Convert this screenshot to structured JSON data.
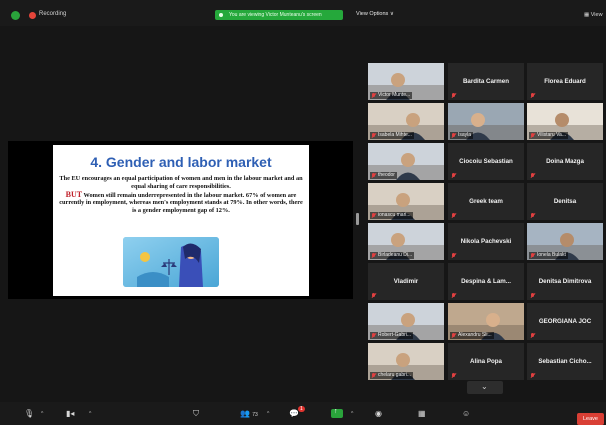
{
  "topbar": {
    "recording_label": "Recording",
    "viewing_banner": "You are viewing Victor Munteanu's screen",
    "view_options": "View Options ∨",
    "view_label": "View"
  },
  "slide": {
    "title": "4. Gender and labor market",
    "para1": "The EU encourages an equal participation of women and men in the labour market and an equal sharing of care responsibilities.",
    "but": "BUT",
    "para2": " Women still remain underrepresented in the labour market. 67% of women are currently in employment, whereas men's employment stands at 79%. In other words, there is a gender employment gap of 12%."
  },
  "participants": [
    {
      "name": "Victor Munte...",
      "video": true,
      "active": true,
      "muted": true
    },
    {
      "name": "Bardita Carmen",
      "video": false,
      "muted": true
    },
    {
      "name": "Florea Eduard",
      "video": false,
      "muted": true
    },
    {
      "name": "Isabela Mihte...",
      "video": true,
      "muted": true
    },
    {
      "name": "Isayla",
      "video": true,
      "muted": true
    },
    {
      "name": "Vilistaru Va...",
      "video": true,
      "muted": true
    },
    {
      "name": "theodor",
      "video": true,
      "muted": true
    },
    {
      "name": "Ciocoiu Sebastian",
      "video": false,
      "muted": true
    },
    {
      "name": "Doina Mazga",
      "video": false,
      "muted": true
    },
    {
      "name": "ionascu mari...",
      "video": true,
      "muted": true
    },
    {
      "name": "Greek team",
      "video": false,
      "muted": true
    },
    {
      "name": "Denitsa",
      "video": false,
      "muted": true
    },
    {
      "name": "Birladeanu Di...",
      "video": true,
      "muted": true
    },
    {
      "name": "Nikola Pachevski",
      "video": false,
      "muted": true
    },
    {
      "name": "Ionela Bulakt",
      "video": true,
      "muted": true
    },
    {
      "name": "Vladimir",
      "video": false,
      "muted": true
    },
    {
      "name": "Despina & Lam...",
      "video": false,
      "muted": true
    },
    {
      "name": "Denitsa Dimitrova",
      "video": false,
      "muted": true
    },
    {
      "name": "Robert-Gabri...",
      "video": true,
      "muted": true
    },
    {
      "name": "Alexandru Sli...",
      "video": true,
      "muted": true
    },
    {
      "name": "GEORGIANA JOC",
      "video": false,
      "muted": true
    },
    {
      "name": "chelaru gabri...",
      "video": true,
      "muted": true
    },
    {
      "name": "Alina Popa",
      "video": false,
      "muted": true
    },
    {
      "name": "Sebastian Cicho...",
      "video": false,
      "muted": true
    }
  ],
  "toolbar": {
    "participants_count": "73",
    "chat_badge": "1",
    "leave_label": "Leave"
  },
  "colors": {
    "accent_green": "#2aa33b",
    "active_speaker": "#c7e34a",
    "leave_red": "#d93f35",
    "slide_title_blue": "#2e5fb4"
  },
  "icons": [
    "shield-icon",
    "record-icon",
    "microphone-muted-icon",
    "video-off-icon",
    "security-icon",
    "participants-icon",
    "chat-icon",
    "share-screen-icon",
    "record-icon",
    "breakout-rooms-icon",
    "reactions-icon",
    "chevron-down-icon",
    "grid-view-icon"
  ]
}
